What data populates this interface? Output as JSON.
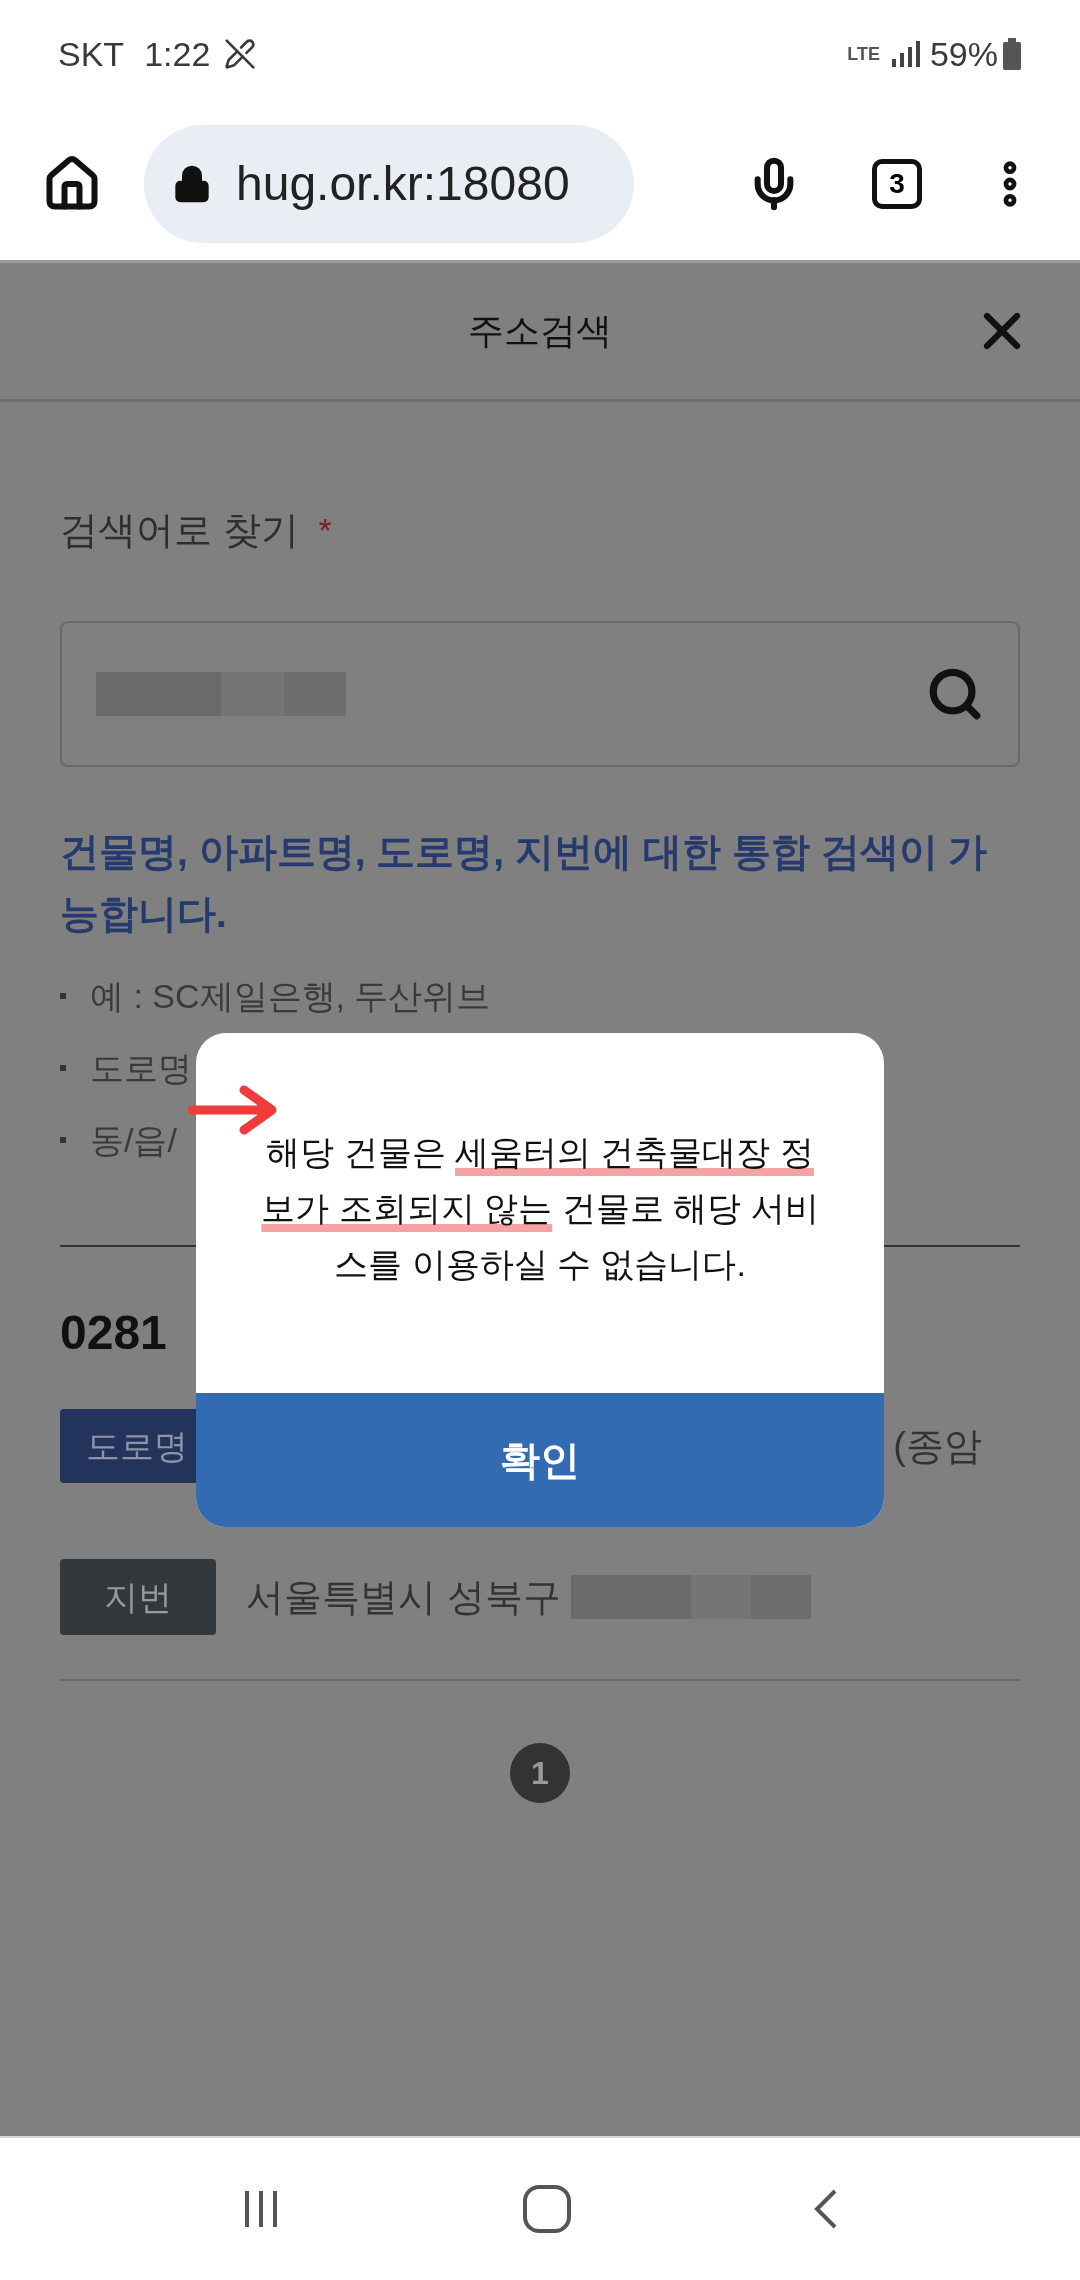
{
  "status_bar": {
    "carrier": "SKT",
    "time": "1:22",
    "network": "LTE",
    "battery": "59%"
  },
  "browser": {
    "url": "hug.or.kr:18080",
    "tab_count": "3"
  },
  "header": {
    "title": "주소검색"
  },
  "search": {
    "label": "검색어로 찾기",
    "required_mark": "*"
  },
  "hint": "건물명, 아파트명, 도로명, 지번에 대한 통합 검색이 가능합니다.",
  "examples": [
    "예 : SC제일은행, 두산위브",
    "도로명",
    "동/읍/"
  ],
  "result": {
    "postcode": "0281",
    "road_tag": "도로명",
    "road_address": "(종암",
    "lot_tag": "지번",
    "lot_address": "서울특별시 성북구"
  },
  "pagination": [
    {
      "label": "1",
      "selected": true
    }
  ],
  "dialog": {
    "message_parts": [
      {
        "text": "해당 건물은 ",
        "underlined": false
      },
      {
        "text": "세움터의 건축물대장 정보가 조회되지 않는",
        "underlined": true
      },
      {
        "text": " 건물로 해당 서비스를 이용하실 수 없습니다.",
        "underlined": false
      }
    ],
    "button": "확인"
  }
}
